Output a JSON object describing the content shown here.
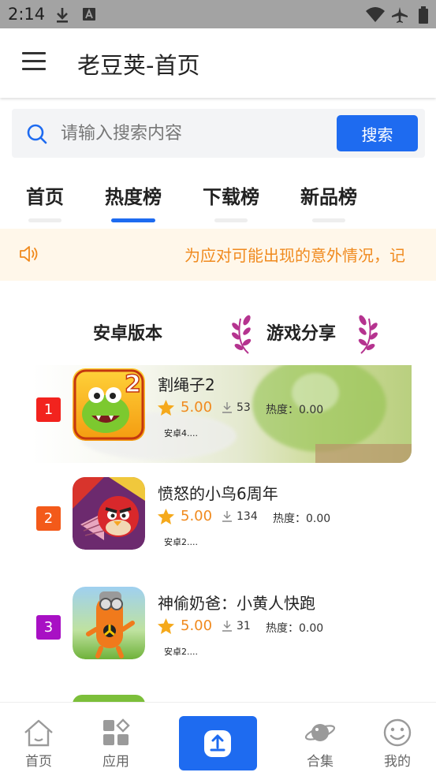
{
  "status_bar": {
    "time": "2:14"
  },
  "header": {
    "title": "老豆荚-首页"
  },
  "search": {
    "placeholder": "请输入搜索内容",
    "button_label": "搜索"
  },
  "tabs": [
    {
      "label": "首页",
      "active": false
    },
    {
      "label": "热度榜",
      "active": true
    },
    {
      "label": "下载榜",
      "active": false
    },
    {
      "label": "新品榜",
      "active": false
    }
  ],
  "notice": {
    "text": "为应对可能出现的意外情况，记"
  },
  "section_tabs": [
    {
      "label": "安卓版本",
      "active": false
    },
    {
      "label": "游戏分享",
      "active": true
    }
  ],
  "apps": [
    {
      "rank": "1",
      "name": "割绳子2",
      "rating": "5.00",
      "downloads": "53",
      "heat": "热度：0.00",
      "version": "安卓4....",
      "badge_color": "#f2231e"
    },
    {
      "rank": "2",
      "name": "愤怒的小鸟6周年",
      "rating": "5.00",
      "downloads": "134",
      "heat": "热度：0.00",
      "version": "安卓2....",
      "badge_color": "#f35a1a"
    },
    {
      "rank": "3",
      "name": "神偷奶爸：小黄人快跑",
      "rating": "5.00",
      "downloads": "31",
      "heat": "热度：0.00",
      "version": "安卓2....",
      "badge_color": "#a810c4"
    }
  ],
  "bottom_nav": [
    {
      "label": "首页",
      "icon": "home-icon"
    },
    {
      "label": "应用",
      "icon": "apps-icon"
    },
    {
      "label": "",
      "icon": "upload-icon"
    },
    {
      "label": "合集",
      "icon": "planet-icon"
    },
    {
      "label": "我的",
      "icon": "smiley-icon"
    }
  ],
  "colors": {
    "accent": "#1e6bf0",
    "notice_text": "#f08a1e",
    "rating": "#f08a1e"
  }
}
